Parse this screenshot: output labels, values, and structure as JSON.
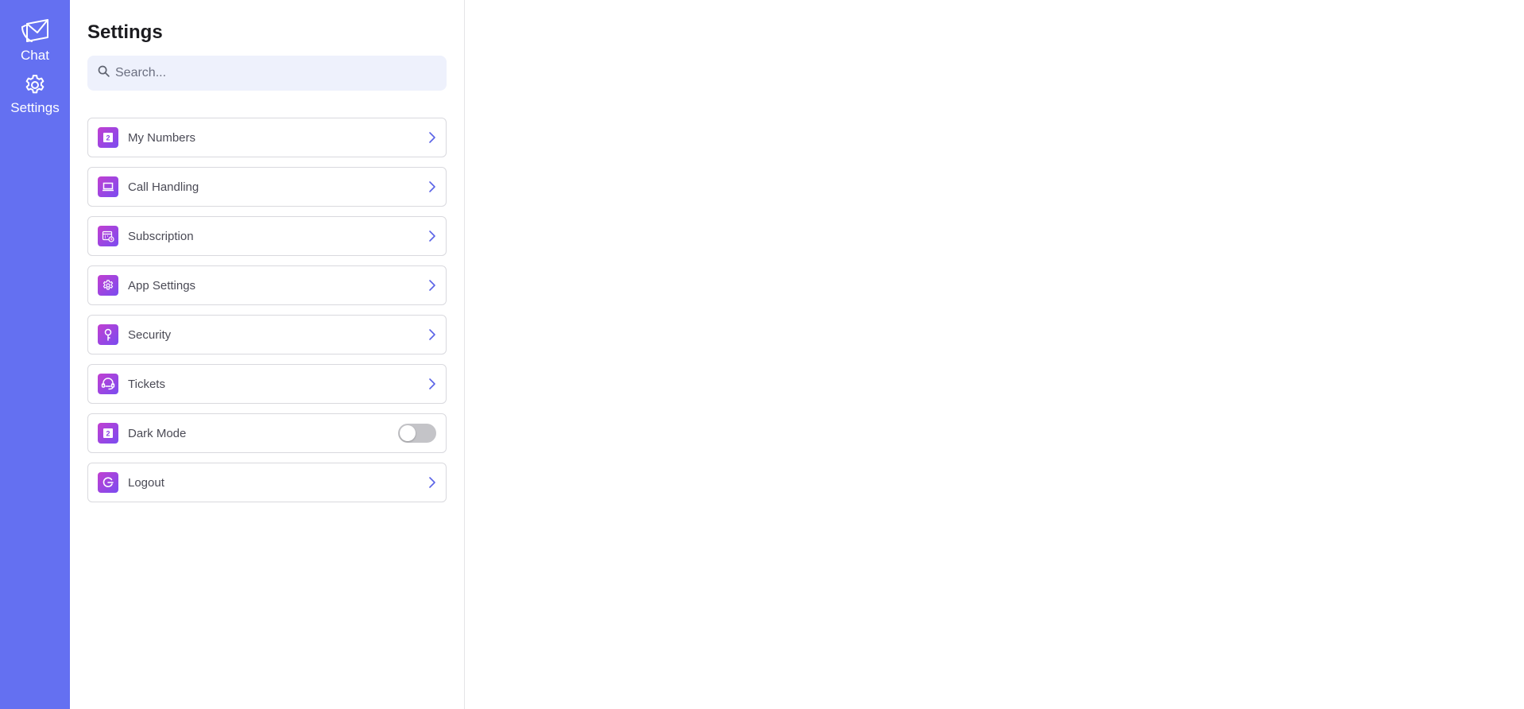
{
  "nav": {
    "items": [
      {
        "label": "Chat",
        "icon": "chat-envelope-icon"
      },
      {
        "label": "Settings",
        "icon": "gear-icon"
      }
    ]
  },
  "settings": {
    "title": "Settings",
    "search": {
      "placeholder": "Search...",
      "value": ""
    },
    "items": [
      {
        "label": "My Numbers",
        "icon": "numbers-icon",
        "control": "chevron"
      },
      {
        "label": "Call Handling",
        "icon": "laptop-icon",
        "control": "chevron"
      },
      {
        "label": "Subscription",
        "icon": "calendar-clock-icon",
        "control": "chevron"
      },
      {
        "label": "App Settings",
        "icon": "gear-icon",
        "control": "chevron"
      },
      {
        "label": "Security",
        "icon": "key-icon",
        "control": "chevron"
      },
      {
        "label": "Tickets",
        "icon": "headset-icon",
        "control": "chevron"
      },
      {
        "label": "Dark Mode",
        "icon": "numbers-icon",
        "control": "toggle",
        "toggle_on": false
      },
      {
        "label": "Logout",
        "icon": "logout-icon",
        "control": "chevron"
      }
    ]
  },
  "colors": {
    "rail": "#6470f1",
    "accent": "#5a63e6",
    "icon_gradient_start": "#c13fd1",
    "icon_gradient_end": "#7a4cf0",
    "search_bg": "#eef1fc"
  }
}
